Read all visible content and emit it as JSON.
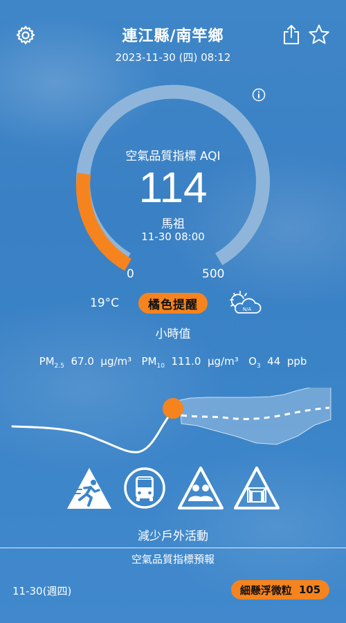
{
  "header": {
    "title": "連江縣/南竿鄉",
    "datetime": "2023-11-30 (四) 08:12",
    "icons": [
      "gear-icon",
      "share-icon",
      "star-icon"
    ]
  },
  "aqi": {
    "label": "空氣品質指標 AQI",
    "value": "114",
    "value_fraction_of_scale": 0.228,
    "station": "馬祖",
    "station_time": "11-30 08:00",
    "scale_min": "0",
    "scale_max": "500",
    "info_icon": "info-icon"
  },
  "conditions": {
    "temperature": "19°C",
    "status": "橘色提醒",
    "weather_icon": "partly-cloudy-icon",
    "weather_icon_label": "N/A",
    "value_type": "小時值"
  },
  "pollutants": [
    {
      "name": "PM",
      "sub": "2.5",
      "value": "67.0",
      "unit": "µg/m³"
    },
    {
      "name": "PM",
      "sub": "10",
      "value": "111.0",
      "unit": "µg/m³"
    },
    {
      "name": "O",
      "sub": "3",
      "value": "44",
      "unit": "ppb"
    }
  ],
  "activity_icons": [
    "running-warning-icon",
    "bus-icon",
    "group-warning-icon",
    "window-warning-icon"
  ],
  "advice": "減少戶外活動",
  "forecast": {
    "title": "空氣品質指標預報",
    "date": "11-30(週四)",
    "badge_label": "細懸浮微粒",
    "badge_value": "105"
  },
  "colors": {
    "accent_orange": "#f5841f",
    "gauge_track": "#8fb6da",
    "background": "#3b84c8"
  }
}
